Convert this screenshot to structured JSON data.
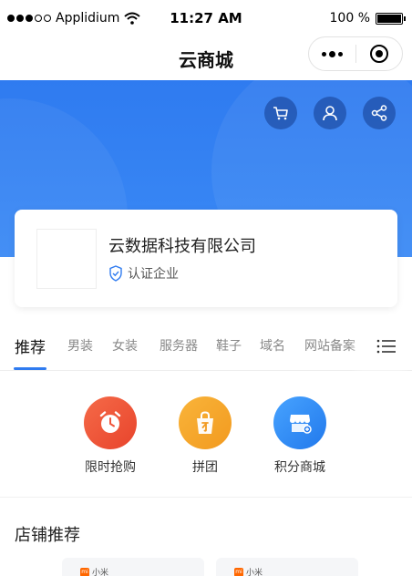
{
  "status_bar": {
    "carrier": "Applidium",
    "time": "11:27 AM",
    "battery": "100 %"
  },
  "nav": {
    "title": "云商城"
  },
  "banner": {
    "icons": [
      "cart-icon",
      "user-icon",
      "share-icon"
    ]
  },
  "company": {
    "name": "云数据科技有限公司",
    "verified_label": "认证企业"
  },
  "tabs": {
    "items": [
      "推荐",
      "男装",
      "女装",
      "服务器",
      "鞋子",
      "域名",
      "网站备案"
    ],
    "active_index": 0
  },
  "entries": {
    "items": [
      {
        "label": "限时抢购",
        "icon": "alarm-clock-icon",
        "color": "#f0543a"
      },
      {
        "label": "拼团",
        "icon": "shopping-bag-icon",
        "color": "#f6a623"
      },
      {
        "label": "积分商城",
        "icon": "store-icon",
        "color": "#2f8cf5"
      }
    ]
  },
  "stores": {
    "title": "店铺推荐",
    "items": [
      {
        "brand": "小米"
      },
      {
        "brand": "小米"
      }
    ]
  },
  "colors": {
    "primary": "#2f7bf0",
    "banner": "#3a89f5"
  }
}
